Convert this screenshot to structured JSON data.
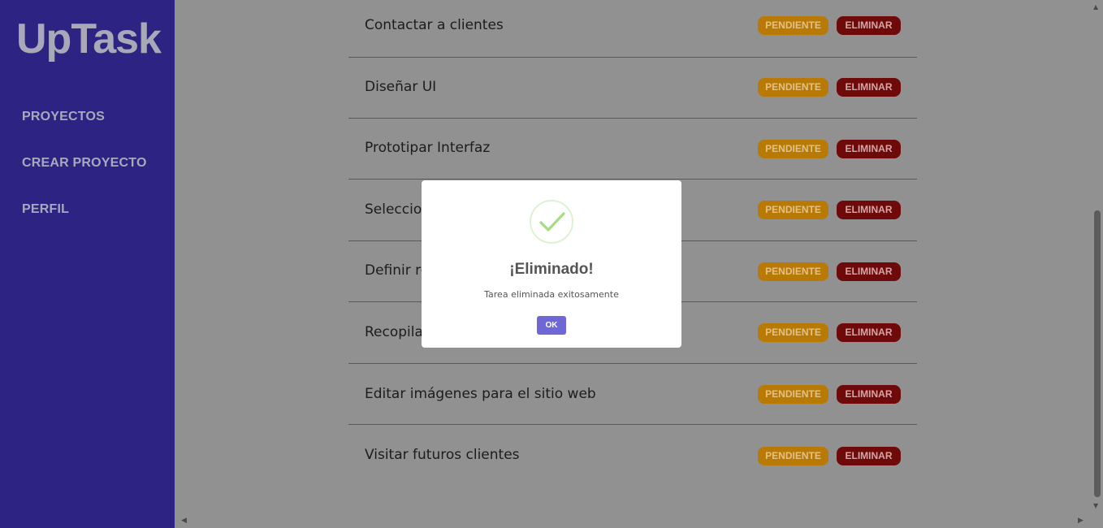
{
  "app": {
    "logo": "UpTask"
  },
  "sidebar": {
    "items": [
      {
        "label": "PROYECTOS"
      },
      {
        "label": "CREAR PROYECTO"
      },
      {
        "label": "PERFIL"
      }
    ]
  },
  "tasks": [
    {
      "name": "Contactar a clientes",
      "status": "PENDIENTE",
      "delete": "ELIMINAR"
    },
    {
      "name": "Diseñar UI",
      "status": "PENDIENTE",
      "delete": "ELIMINAR"
    },
    {
      "name": "Prototipar Interfaz",
      "status": "PENDIENTE",
      "delete": "ELIMINAR"
    },
    {
      "name": "Seleccion",
      "status": "PENDIENTE",
      "delete": "ELIMINAR"
    },
    {
      "name": "Definir ro",
      "status": "PENDIENTE",
      "delete": "ELIMINAR"
    },
    {
      "name": "Recopilar",
      "status": "PENDIENTE",
      "delete": "ELIMINAR"
    },
    {
      "name": "Editar imágenes para el sitio web",
      "status": "PENDIENTE",
      "delete": "ELIMINAR"
    },
    {
      "name": "Visitar futuros clientes",
      "status": "PENDIENTE",
      "delete": "ELIMINAR"
    }
  ],
  "modal": {
    "title": "¡Eliminado!",
    "text": "Tarea eliminada exitosamente",
    "ok": "OK",
    "icon": "success-check-icon"
  },
  "colors": {
    "sidebar": "#2d2383",
    "pending": "#b87a05",
    "delete": "#6f0a0a",
    "ok_button": "#7067d6",
    "success": "#a5dc86"
  }
}
